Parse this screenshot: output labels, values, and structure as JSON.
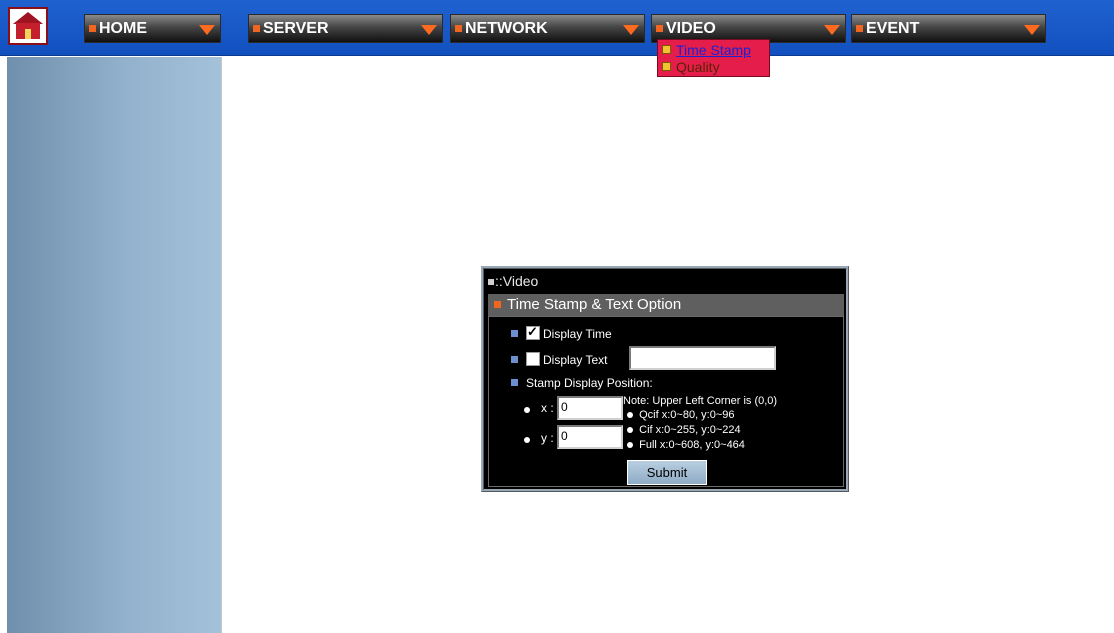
{
  "nav": {
    "home": "HOME",
    "server": "SERVER",
    "network": "NETWORK",
    "video": "VIDEO",
    "event": "EVENT"
  },
  "dropdown": {
    "items": [
      "Time Stamp",
      "Quality"
    ]
  },
  "panel": {
    "title": "::Video",
    "section": "Time Stamp & Text Option",
    "display_time_label": "Display Time",
    "display_time_checked": true,
    "display_text_label": "Display Text",
    "display_text_checked": false,
    "display_text_value": "",
    "stamp_position_label": "Stamp Display Position:",
    "x_label": "x :",
    "x_value": "0",
    "y_label": "y :",
    "y_value": "0",
    "note": "Note: Upper Left Corner is (0,0)",
    "ranges": [
      "Qcif  x:0~80,  y:0~96",
      "Cif   x:0~255, y:0~224",
      "Full  x:0~608, y:0~464"
    ],
    "submit_label": "Submit"
  },
  "colors": {
    "topbar": "#1f62cf",
    "dropdown_bg": "#e51d4a",
    "accent_orange": "#f06520",
    "sidebar": "#92b1cc"
  }
}
